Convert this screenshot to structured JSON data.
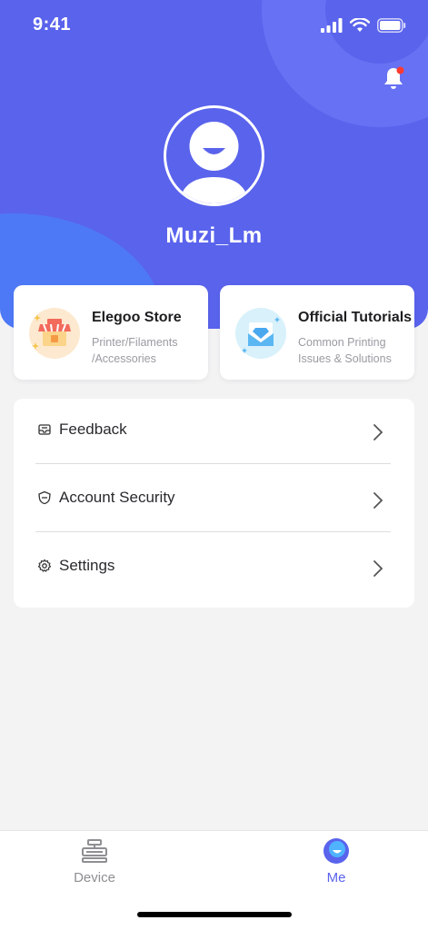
{
  "status_bar": {
    "time": "9:41"
  },
  "profile": {
    "username": "Muzi_Lm"
  },
  "cards": {
    "store": {
      "title": "Elegoo Store",
      "subtitle_line1": "Printer/Filaments",
      "subtitle_line2": "/Accessories",
      "icon": "shop-icon"
    },
    "tutorials": {
      "title": "Official Tutorials",
      "subtitle_line1": "Common Printing",
      "subtitle_line2": "Issues & Solutions",
      "icon": "mail-diamond-icon"
    }
  },
  "menu": {
    "items": [
      {
        "label": "Feedback",
        "icon": "feedback-icon"
      },
      {
        "label": "Account Security",
        "icon": "shield-icon"
      },
      {
        "label": "Settings",
        "icon": "gear-icon"
      }
    ]
  },
  "tabbar": {
    "tabs": [
      {
        "label": "Device",
        "icon": "printer-icon",
        "active": false
      },
      {
        "label": "Me",
        "icon": "smile-face-icon",
        "active": true
      }
    ]
  },
  "colors": {
    "accent": "#5a63ec",
    "tab_inactive": "#8e8e93",
    "notification_dot": "#ff3b30"
  }
}
